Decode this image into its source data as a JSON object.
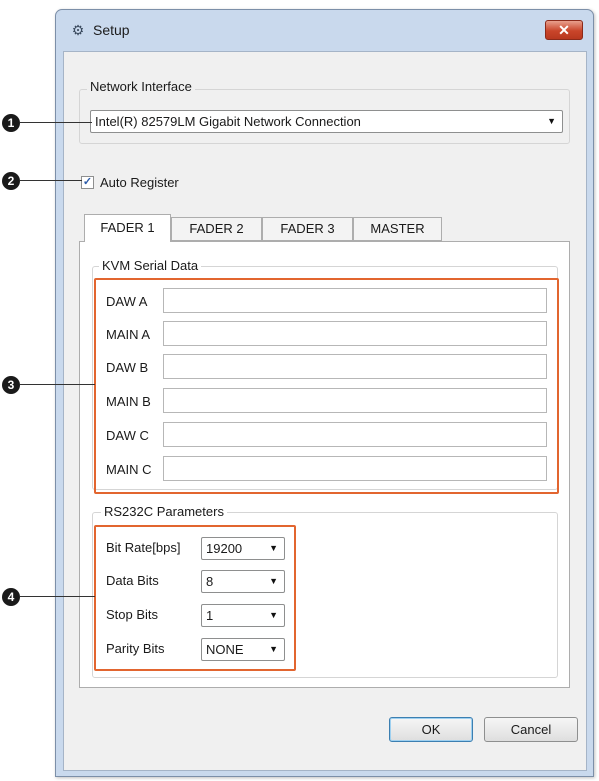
{
  "window": {
    "title": "Setup",
    "title_icon": "gear-icon",
    "close_icon": "close-icon"
  },
  "network": {
    "group_label": "Network Interface",
    "selected": "Intel(R) 82579LM Gigabit Network Connection"
  },
  "auto_register": {
    "label": "Auto Register",
    "checked": true
  },
  "tabs": [
    {
      "label": "FADER 1",
      "active": true
    },
    {
      "label": "FADER 2",
      "active": false
    },
    {
      "label": "FADER 3",
      "active": false
    },
    {
      "label": "MASTER",
      "active": false
    }
  ],
  "kvm": {
    "group_label": "KVM Serial Data",
    "fields": [
      {
        "label": "DAW A",
        "value": ""
      },
      {
        "label": "MAIN A",
        "value": ""
      },
      {
        "label": "DAW B",
        "value": ""
      },
      {
        "label": "MAIN B",
        "value": ""
      },
      {
        "label": "DAW C",
        "value": ""
      },
      {
        "label": "MAIN C",
        "value": ""
      }
    ]
  },
  "rs232c": {
    "group_label": "RS232C Parameters",
    "params": [
      {
        "label": "Bit Rate[bps]",
        "value": "19200"
      },
      {
        "label": "Data Bits",
        "value": "8"
      },
      {
        "label": "Stop Bits",
        "value": "1"
      },
      {
        "label": "Parity Bits",
        "value": "NONE"
      }
    ]
  },
  "buttons": {
    "ok": "OK",
    "cancel": "Cancel"
  },
  "callouts": [
    "1",
    "2",
    "3",
    "4"
  ],
  "colors": {
    "highlight": "#e2652f",
    "window_frame": "#c9d9ed",
    "close_button": "#c9452a"
  }
}
